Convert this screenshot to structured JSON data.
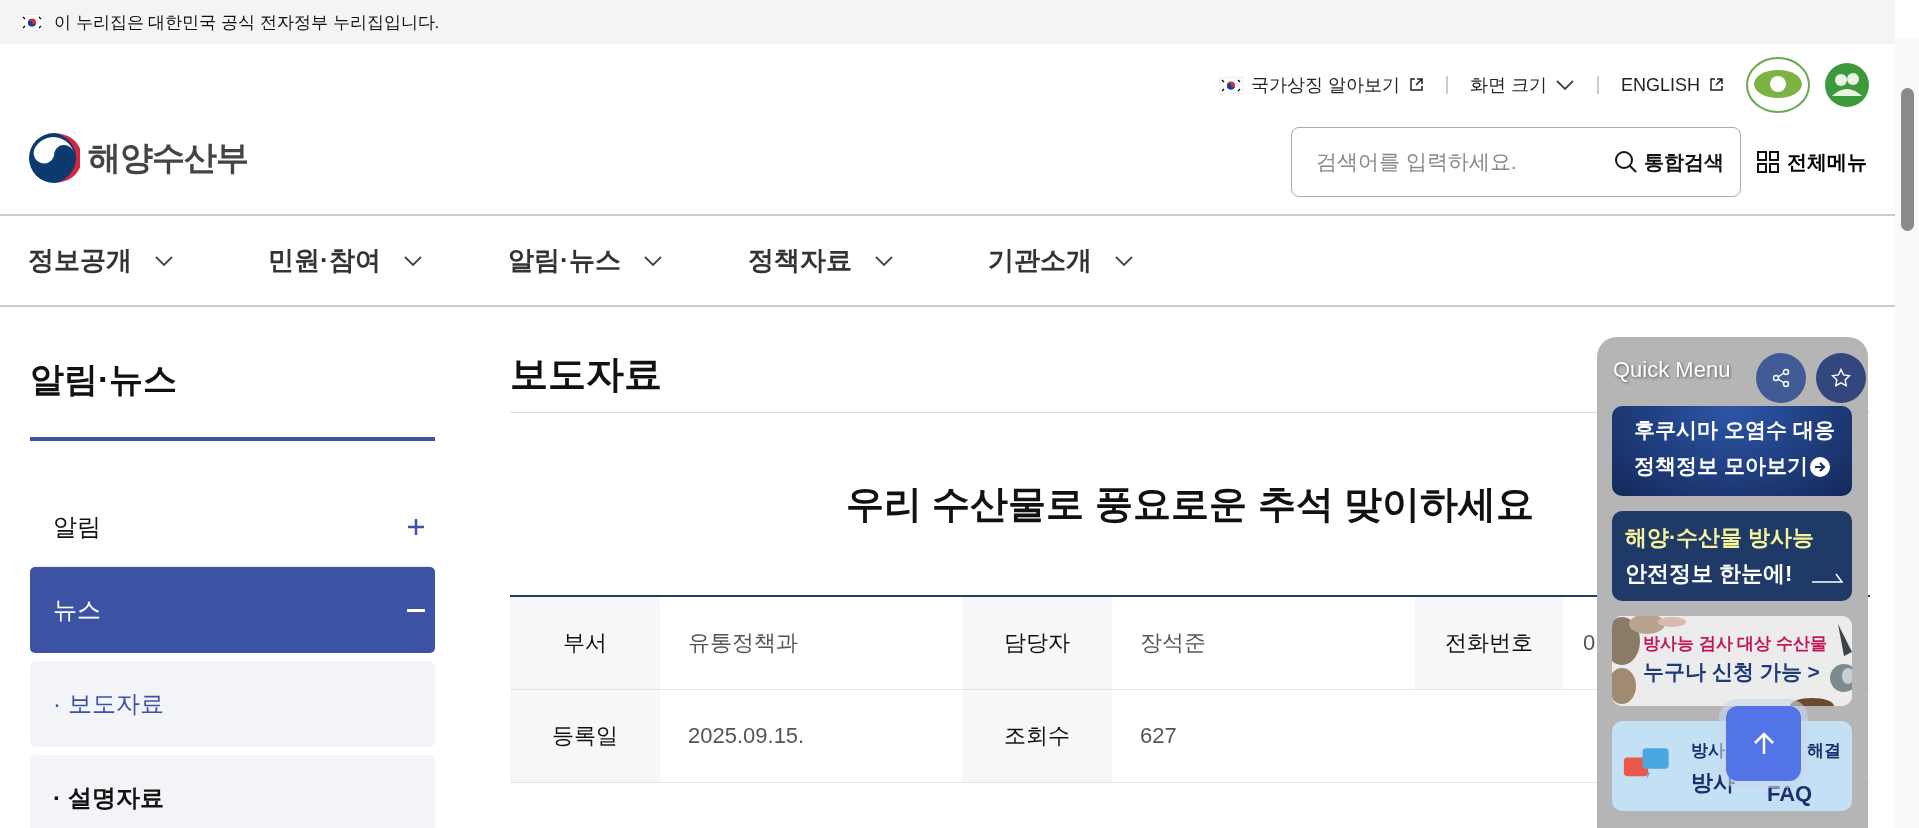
{
  "gov_banner": {
    "text": "이 누리집은 대한민국 공식 전자정부 누리집입니다."
  },
  "utility_links": [
    {
      "label": "국가상징 알아보기",
      "kind": "symbol"
    },
    {
      "label": "화면 크기",
      "kind": "dropdown"
    },
    {
      "label": "ENGLISH",
      "kind": "external"
    }
  ],
  "logo": {
    "text": "해양수산부"
  },
  "search": {
    "placeholder": "검색어를 입력하세요.",
    "button": "통합검색"
  },
  "all_menu": {
    "label": "전체메뉴"
  },
  "nav": [
    {
      "label": "정보공개"
    },
    {
      "label": "민원·참여"
    },
    {
      "label": "알림·뉴스"
    },
    {
      "label": "정책자료"
    },
    {
      "label": "기관소개"
    }
  ],
  "sidebar": {
    "title": "알림·뉴스",
    "items": [
      {
        "label": "알림",
        "expanded": false
      },
      {
        "label": "뉴스",
        "expanded": true,
        "children": [
          {
            "bullet": "·",
            "label": "보도자료",
            "selected": true
          },
          {
            "bullet": "·",
            "label": "설명자료",
            "selected": false
          }
        ]
      }
    ]
  },
  "page": {
    "title": "보도자료"
  },
  "article": {
    "title": "우리 수산물로 풍요로운 추석 맞이하세요",
    "meta": [
      [
        {
          "label": "부서",
          "value": "유통정책과"
        },
        {
          "label": "담당자",
          "value": "장석준"
        },
        {
          "label": "전화번호",
          "value": "0"
        }
      ],
      [
        {
          "label": "등록일",
          "value": "2025.09.15."
        },
        {
          "label": "조회수",
          "value": "627"
        }
      ]
    ]
  },
  "quick_menu": {
    "title": "Quick Menu",
    "banners": [
      {
        "kind": "dark",
        "lines": [
          "후쿠시마 오염수 대응",
          "정책정보 모아보기"
        ]
      },
      {
        "kind": "navy",
        "lines": [
          "해양·수산물 방사능",
          "안전정보 한눈에!"
        ]
      },
      {
        "lines": [
          "방사능 검사 대상 수산물",
          "누구나 신청 가능 >"
        ]
      },
      {
        "kind": "faq",
        "lines": [
          "방사",
          "해결",
          "방사",
          "FAQ"
        ]
      }
    ]
  }
}
